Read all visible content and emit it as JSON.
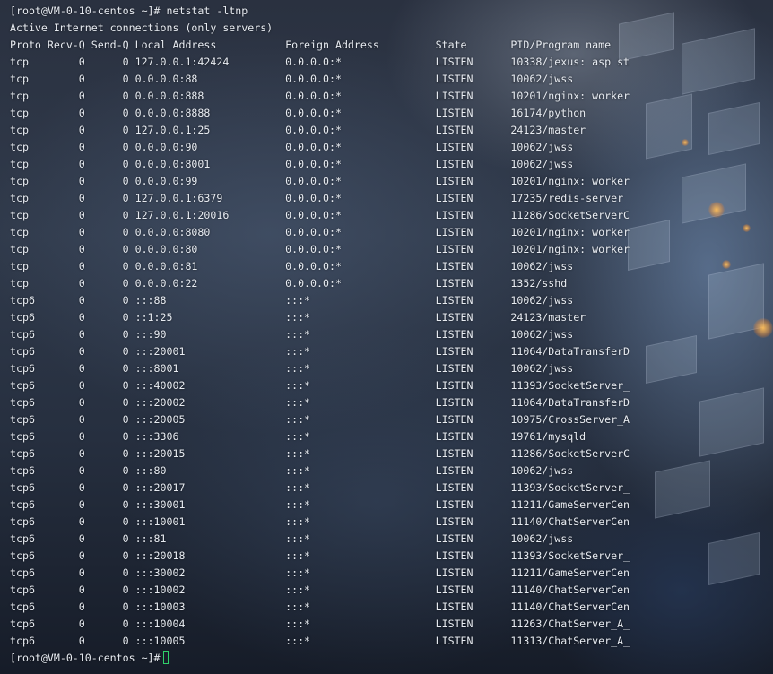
{
  "terminal": {
    "accent_cursor_color": "#2fd06a",
    "text_color": "#e8ecf2",
    "lines": [
      "[root@VM-0-10-centos ~]# netstat -ltnp",
      "Active Internet connections (only servers)",
      "Proto Recv-Q Send-Q Local Address           Foreign Address         State       PID/Program name",
      "tcp        0      0 127.0.0.1:42424         0.0.0.0:*               LISTEN      10338/jexus: asp st",
      "tcp        0      0 0.0.0.0:88              0.0.0.0:*               LISTEN      10062/jwss",
      "tcp        0      0 0.0.0.0:888             0.0.0.0:*               LISTEN      10201/nginx: worker",
      "tcp        0      0 0.0.0.0:8888            0.0.0.0:*               LISTEN      16174/python",
      "tcp        0      0 127.0.0.1:25            0.0.0.0:*               LISTEN      24123/master",
      "tcp        0      0 0.0.0.0:90              0.0.0.0:*               LISTEN      10062/jwss",
      "tcp        0      0 0.0.0.0:8001            0.0.0.0:*               LISTEN      10062/jwss",
      "tcp        0      0 0.0.0.0:99              0.0.0.0:*               LISTEN      10201/nginx: worker",
      "tcp        0      0 127.0.0.1:6379          0.0.0.0:*               LISTEN      17235/redis-server",
      "tcp        0      0 127.0.0.1:20016         0.0.0.0:*               LISTEN      11286/SocketServerC",
      "tcp        0      0 0.0.0.0:8080            0.0.0.0:*               LISTEN      10201/nginx: worker",
      "tcp        0      0 0.0.0.0:80              0.0.0.0:*               LISTEN      10201/nginx: worker",
      "tcp        0      0 0.0.0.0:81              0.0.0.0:*               LISTEN      10062/jwss",
      "tcp        0      0 0.0.0.0:22              0.0.0.0:*               LISTEN      1352/sshd",
      "tcp6       0      0 :::88                   :::*                    LISTEN      10062/jwss",
      "tcp6       0      0 ::1:25                  :::*                    LISTEN      24123/master",
      "tcp6       0      0 :::90                   :::*                    LISTEN      10062/jwss",
      "tcp6       0      0 :::20001                :::*                    LISTEN      11064/DataTransferD",
      "tcp6       0      0 :::8001                 :::*                    LISTEN      10062/jwss",
      "tcp6       0      0 :::40002                :::*                    LISTEN      11393/SocketServer_",
      "tcp6       0      0 :::20002                :::*                    LISTEN      11064/DataTransferD",
      "tcp6       0      0 :::20005                :::*                    LISTEN      10975/CrossServer_A",
      "tcp6       0      0 :::3306                 :::*                    LISTEN      19761/mysqld",
      "tcp6       0      0 :::20015                :::*                    LISTEN      11286/SocketServerC",
      "tcp6       0      0 :::80                   :::*                    LISTEN      10062/jwss",
      "tcp6       0      0 :::20017                :::*                    LISTEN      11393/SocketServer_",
      "tcp6       0      0 :::30001                :::*                    LISTEN      11211/GameServerCen",
      "tcp6       0      0 :::10001                :::*                    LISTEN      11140/ChatServerCen",
      "tcp6       0      0 :::81                   :::*                    LISTEN      10062/jwss",
      "tcp6       0      0 :::20018                :::*                    LISTEN      11393/SocketServer_",
      "tcp6       0      0 :::30002                :::*                    LISTEN      11211/GameServerCen",
      "tcp6       0      0 :::10002                :::*                    LISTEN      11140/ChatServerCen",
      "tcp6       0      0 :::10003                :::*                    LISTEN      11140/ChatServerCen",
      "tcp6       0      0 :::10004                :::*                    LISTEN      11263/ChatServer_A_",
      "tcp6       0      0 :::10005                :::*                    LISTEN      11313/ChatServer_A_"
    ],
    "prompt": "[root@VM-0-10-centos ~]#"
  }
}
